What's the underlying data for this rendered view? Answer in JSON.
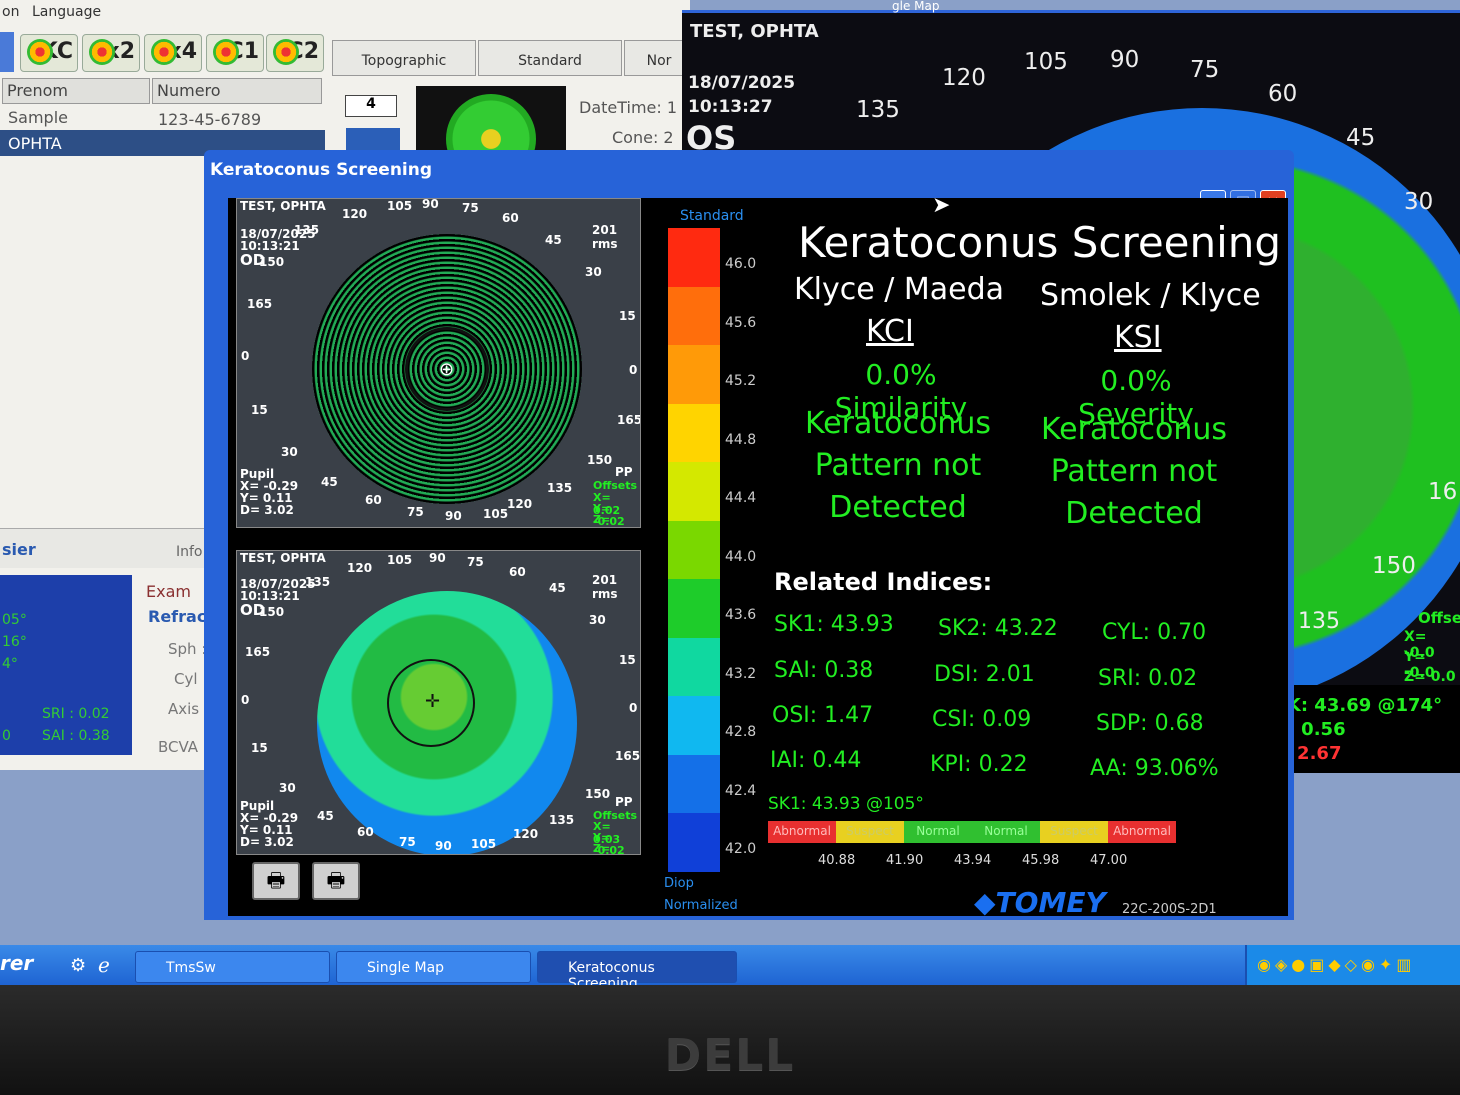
{
  "back_app": {
    "menu": [
      "on",
      "Language"
    ],
    "toolbar": [
      "KC",
      "x2",
      "x4",
      "C1",
      "C2"
    ],
    "tabs": [
      "Topographic",
      "Standard",
      "Nor"
    ],
    "columns": [
      "Prenom",
      "Numero"
    ],
    "rows": [
      {
        "prenom": "Sample",
        "numero": "123-45-6789"
      },
      {
        "prenom": "OPHTA",
        "numero": ""
      }
    ],
    "exam_number": "4",
    "datetime_label": "DateTime: 1",
    "cone_label": "Cone: 2",
    "sections": {
      "dossier": "sier",
      "info": "Info"
    },
    "left_panel": {
      "angles": [
        "05°",
        "16°",
        "4°"
      ],
      "sri": "SRI : 0.02",
      "sai": "SAI : 0.38",
      "zero": "0"
    },
    "exam": {
      "title": "Exam",
      "refraction": "Refracti",
      "sph": "Sph :",
      "cyl": "Cyl :",
      "axis": "Axis :",
      "bcva": "BCVA :"
    }
  },
  "os_map": {
    "window_title_fragment": "gle Map",
    "patient": "TEST, OPHTA",
    "date": "18/07/2025",
    "time": "10:13:27",
    "eye": "OS",
    "angles": [
      "105",
      "90",
      "75",
      "60",
      "45",
      "30",
      "120",
      "135",
      "150",
      "16"
    ],
    "offset_label": "Offse",
    "offsets": [
      "X= -0.0",
      "Y= -0.0",
      "Z= 0.0"
    ],
    "mink": "MinK: 43.69 @174°",
    "cyl": "CYL: 0.56",
    "sai": "SAI: 2.67"
  },
  "dialog": {
    "title": "Keratoconus Screening",
    "map_top": {
      "patient": "TEST, OPHTA",
      "date": "18/07/2025",
      "time": "10:13:21",
      "eye": "OD",
      "rings": "201 rms",
      "pupil": "Pupil",
      "px": "X= -0.29",
      "py": "Y= 0.11",
      "pd": "D= 3.02",
      "pp": "PP",
      "offsets": "Offsets",
      "ox": "X= 0.02",
      "oy": "Y= -0.02",
      "oz": "Z= 0.08",
      "angles": [
        "105",
        "90",
        "75",
        "120",
        "60",
        "135",
        "45",
        "150",
        "30",
        "165",
        "15",
        "0",
        "0",
        "15",
        "165",
        "30",
        "150",
        "45",
        "135",
        "60",
        "120",
        "75",
        "90",
        "105"
      ]
    },
    "map_bottom": {
      "patient": "TEST, OPHTA",
      "date": "18/07/2025",
      "time": "10:13:21",
      "eye": "OD",
      "rings": "201 rms",
      "pupil": "Pupil",
      "px": "X= -0.29",
      "py": "Y= 0.11",
      "pd": "D= 3.02",
      "pp": "PP",
      "offsets": "Offsets",
      "ox": "X= 0.03",
      "oy": "Y= -0.02",
      "oz": "Z= 0.08",
      "angles": [
        "105",
        "90",
        "75",
        "120",
        "60",
        "135",
        "45",
        "150",
        "30",
        "165",
        "15",
        "0",
        "0",
        "15",
        "165",
        "30",
        "150",
        "45",
        "135",
        "60",
        "120",
        "75",
        "90",
        "105"
      ]
    },
    "scale": {
      "title": "Standard",
      "values": [
        "46.0",
        "45.6",
        "45.2",
        "44.8",
        "44.4",
        "44.0",
        "43.6",
        "43.2",
        "42.8",
        "42.4",
        "42.0"
      ],
      "colors": [
        "#ff2a10",
        "#ff6e0c",
        "#ff9a08",
        "#ffd400",
        "#d4e800",
        "#7ad800",
        "#1ecc2a",
        "#10d8a0",
        "#10b8f0",
        "#1470e8",
        "#1040d8"
      ],
      "unit": "Diop",
      "mode": "Normalized"
    },
    "heading": "Keratoconus Screening",
    "kci": {
      "author": "Klyce / Maeda",
      "name": "KCI",
      "value": "0.0% Similarity",
      "result": [
        "Keratoconus",
        "Pattern not",
        "Detected"
      ]
    },
    "ksi": {
      "author": "Smolek / Klyce",
      "name": "KSI",
      "value": "0.0% Severity",
      "result": [
        "Keratoconus",
        "Pattern not",
        "Detected"
      ]
    },
    "related_title": "Related Indices:",
    "indices": [
      [
        "SK1: 43.93",
        "SK2: 43.22",
        "CYL: 0.70"
      ],
      [
        "SAI: 0.38",
        "DSI: 2.01",
        "SRI: 0.02"
      ],
      [
        "OSI: 1.47",
        "CSI: 0.09",
        "SDP: 0.68"
      ],
      [
        "IAI: 0.44",
        "KPI: 0.22",
        "AA: 93.06%"
      ]
    ],
    "sk1_axis": "SK1: 43.93 @105°",
    "legend": [
      {
        "label": "Abnormal",
        "color": "#e83030"
      },
      {
        "label": "Suspect",
        "color": "#e8d020"
      },
      {
        "label": "Normal",
        "color": "#30c030"
      },
      {
        "label": "Normal",
        "color": "#30c030"
      },
      {
        "label": "Suspect",
        "color": "#e8d020"
      },
      {
        "label": "Abnormal",
        "color": "#e83030"
      }
    ],
    "legend_values": [
      "40.88",
      "41.90",
      "43.94",
      "45.98",
      "47.00"
    ],
    "brand": "TOMEY",
    "model": "22C-200S-2D1"
  },
  "taskbar": {
    "start": "rer",
    "tasks": [
      "TmsSw",
      "Single Map",
      "Keratoconus Screening"
    ]
  },
  "monitor_brand": "DELL"
}
